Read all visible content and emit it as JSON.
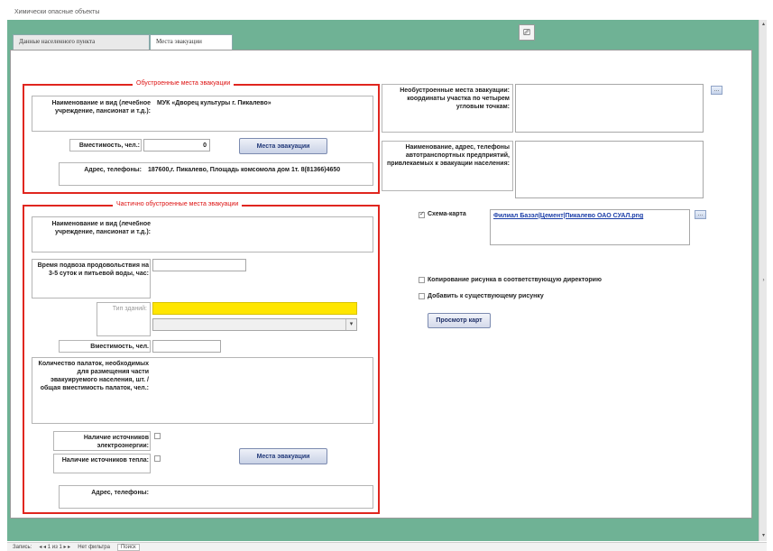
{
  "window": {
    "title": "Химически опасные объекты"
  },
  "toolbar": {
    "icon_glyph": "⎚"
  },
  "tabs": [
    {
      "label": "Данные населенного пункта"
    },
    {
      "label": "Места эвакуации"
    }
  ],
  "equipped": {
    "title": "Обустроенные места эвакуации",
    "name_label": "Наименование и вид (лечебное учреждение, пансионат и т.д.):",
    "name_value": "МУК «Дворец культуры г. Пикалево»",
    "capacity_label": "Вместимость, чел.:",
    "capacity_value": "0",
    "places_button": "Места эвакуации",
    "address_label": "Адрес, телефоны:",
    "address_value": "187600,г. Пикалево, Площадь комсомола дом 1т. 8(81366)4650"
  },
  "partial": {
    "title": "Частично обустроенные места эвакуации",
    "name_label": "Наименование и вид (лечебное учреждение, пансионат и т.д.):",
    "name_value": "",
    "food_label": "Время подвоза продовольствия на 3-5 суток и питьевой воды, час:",
    "food_value": "",
    "building_type_label": "Тип зданий:",
    "building_type_value": "",
    "capacity_label": "Вместимость, чел.",
    "capacity_value": "",
    "tents_label": "Количество палаток, необходимых для размещения части эвакуируемого населения, шт. /общая вместимость палаток, чел.:",
    "tents_value": "",
    "power_label": "Наличие источников электроэнергии:",
    "heat_label": "Наличие источников тепла:",
    "places_button": "Места эвакуации",
    "address_label": "Адрес, телефоны:",
    "address_value": ""
  },
  "right": {
    "unequipped_label": "Необустроенные места эвакуации: координаты участка по четырем угловым точкам:",
    "unequipped_value": "",
    "transport_label": "Наименование, адрес, телефоны автотранспортных предприятий, привлекаемых к эвакуации населения:",
    "transport_value": "",
    "scheme_label": "Схема-карта",
    "scheme_link": "Филиал Базэл|Цемент|Пикалево ОАО СУАЛ.png",
    "copy_label": "Копирование рисунка в соответствующую директорию",
    "add_label": "Добавить к существующему рисунку",
    "view_button": "Просмотр карт"
  },
  "statusbar": {
    "record_label": "Запись:",
    "record_nav": "◂ ◂ 1 из 1 ▸ ▸",
    "filter": "Нет фильтра",
    "search": "Поиск"
  },
  "colors": {
    "frame_green": "#6fb295",
    "group_border": "#e0261f",
    "highlight_yellow": "#ffe600"
  }
}
